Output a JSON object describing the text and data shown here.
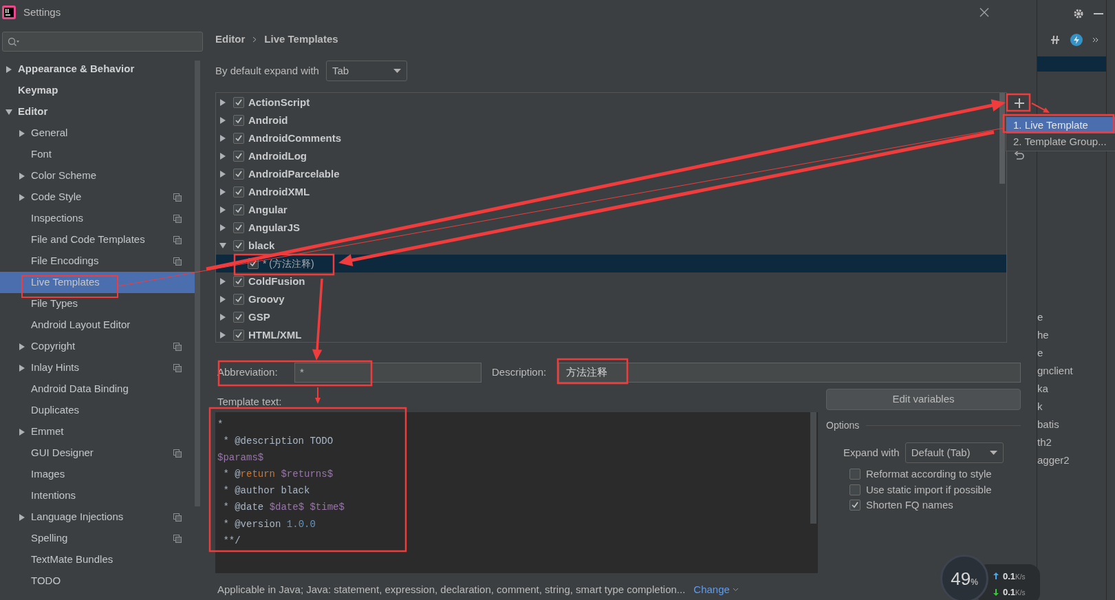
{
  "window": {
    "title": "Settings"
  },
  "sidebar": {
    "items": [
      {
        "label": "Appearance & Behavior",
        "selected": false,
        "expanded": false,
        "project_scope": false
      },
      {
        "label": "Keymap",
        "selected": false,
        "project_scope": false
      },
      {
        "label": "Editor",
        "selected": false,
        "expanded": true,
        "project_scope": false,
        "children": [
          {
            "label": "General",
            "selected": false,
            "expanded": false,
            "project_scope": false
          },
          {
            "label": "Font",
            "selected": false,
            "project_scope": false
          },
          {
            "label": "Color Scheme",
            "selected": false,
            "expanded": false,
            "project_scope": false
          },
          {
            "label": "Code Style",
            "selected": false,
            "expanded": false,
            "project_scope": true
          },
          {
            "label": "Inspections",
            "selected": false,
            "project_scope": true
          },
          {
            "label": "File and Code Templates",
            "selected": false,
            "project_scope": true
          },
          {
            "label": "File Encodings",
            "selected": false,
            "project_scope": true
          },
          {
            "label": "Live Templates",
            "selected": true,
            "project_scope": false
          },
          {
            "label": "File Types",
            "selected": false,
            "project_scope": false
          },
          {
            "label": "Android Layout Editor",
            "selected": false,
            "project_scope": false
          },
          {
            "label": "Copyright",
            "selected": false,
            "expanded": false,
            "project_scope": true
          },
          {
            "label": "Inlay Hints",
            "selected": false,
            "expanded": false,
            "project_scope": true
          },
          {
            "label": "Android Data Binding",
            "selected": false,
            "project_scope": false
          },
          {
            "label": "Duplicates",
            "selected": false,
            "project_scope": false
          },
          {
            "label": "Emmet",
            "selected": false,
            "expanded": false,
            "project_scope": false
          },
          {
            "label": "GUI Designer",
            "selected": false,
            "project_scope": true
          },
          {
            "label": "Images",
            "selected": false,
            "project_scope": false
          },
          {
            "label": "Intentions",
            "selected": false,
            "project_scope": false
          },
          {
            "label": "Language Injections",
            "selected": false,
            "expanded": false,
            "project_scope": true
          },
          {
            "label": "Spelling",
            "selected": false,
            "project_scope": true
          },
          {
            "label": "TextMate Bundles",
            "selected": false,
            "project_scope": false
          },
          {
            "label": "TODO",
            "selected": false,
            "project_scope": false
          }
        ]
      }
    ]
  },
  "breadcrumb": [
    "Editor",
    "Live Templates"
  ],
  "expand_default": {
    "label": "By default expand with",
    "value": "Tab"
  },
  "template_groups": [
    {
      "name": "ActionScript",
      "checked": true,
      "expanded": false,
      "selected": false
    },
    {
      "name": "Android",
      "checked": true,
      "expanded": false,
      "selected": false
    },
    {
      "name": "AndroidComments",
      "checked": true,
      "expanded": false,
      "selected": false
    },
    {
      "name": "AndroidLog",
      "checked": true,
      "expanded": false,
      "selected": false
    },
    {
      "name": "AndroidParcelable",
      "checked": true,
      "expanded": false,
      "selected": false
    },
    {
      "name": "AndroidXML",
      "checked": true,
      "expanded": false,
      "selected": false
    },
    {
      "name": "Angular",
      "checked": true,
      "expanded": false,
      "selected": false
    },
    {
      "name": "AngularJS",
      "checked": true,
      "expanded": false,
      "selected": false
    },
    {
      "name": "black",
      "checked": true,
      "expanded": true,
      "selected": false,
      "children": [
        {
          "name": "* (方法注释)",
          "checked": true,
          "selected": true
        }
      ]
    },
    {
      "name": "ColdFusion",
      "checked": true,
      "expanded": false,
      "selected": false
    },
    {
      "name": "Groovy",
      "checked": true,
      "expanded": false,
      "selected": false
    },
    {
      "name": "GSP",
      "checked": true,
      "expanded": false,
      "selected": false
    },
    {
      "name": "HTML/XML",
      "checked": true,
      "expanded": false,
      "selected": false
    }
  ],
  "add_menu": [
    {
      "label": "1. Live Template",
      "selected": true
    },
    {
      "label": "2. Template Group...",
      "selected": false
    }
  ],
  "abbreviation": {
    "label": "Abbreviation:",
    "value": "*"
  },
  "description": {
    "label": "Description:",
    "value": "方法注释"
  },
  "template_text": {
    "label": "Template text:",
    "lines": [
      [
        {
          "text": "*",
          "kind": "plain"
        }
      ],
      [
        {
          "text": " * @description TODO",
          "kind": "plain"
        }
      ],
      [
        {
          "text": "$params$",
          "kind": "variable"
        }
      ],
      [
        {
          "text": " * @",
          "kind": "plain"
        },
        {
          "text": "return",
          "kind": "keyword"
        },
        {
          "text": " $returns$",
          "kind": "variable"
        }
      ],
      [
        {
          "text": " * @author black",
          "kind": "plain"
        }
      ],
      [
        {
          "text": " * @date ",
          "kind": "plain"
        },
        {
          "text": "$date$ $time$",
          "kind": "variable"
        }
      ],
      [
        {
          "text": " * @version ",
          "kind": "plain"
        },
        {
          "text": "1.0.0",
          "kind": "number"
        }
      ],
      [
        {
          "text": " **/",
          "kind": "plain"
        }
      ]
    ]
  },
  "edit_variables": "Edit variables",
  "options": {
    "title": "Options",
    "expand_with": {
      "label": "Expand with",
      "value": "Default (Tab)"
    },
    "checkboxes": [
      {
        "label": "Reformat according to style",
        "checked": false
      },
      {
        "label": "Use static import if possible",
        "checked": false
      },
      {
        "label": "Shorten FQ names",
        "checked": true
      }
    ]
  },
  "footer": {
    "text": "Applicable in Java; Java: statement, expression, declaration, comment, string, smart type completion...",
    "link": "Change"
  },
  "background_ide": {
    "list_fragments": [
      "e",
      "he",
      "e",
      "gnclient",
      "ka",
      "k",
      "batis",
      "th2",
      "agger2"
    ]
  },
  "monitor": {
    "value": "49",
    "unit": "%",
    "speeds": [
      {
        "kind": "upload",
        "value": "0.1",
        "unit": "K/s"
      },
      {
        "kind": "download",
        "value": "0.1",
        "unit": "K/s"
      }
    ]
  }
}
